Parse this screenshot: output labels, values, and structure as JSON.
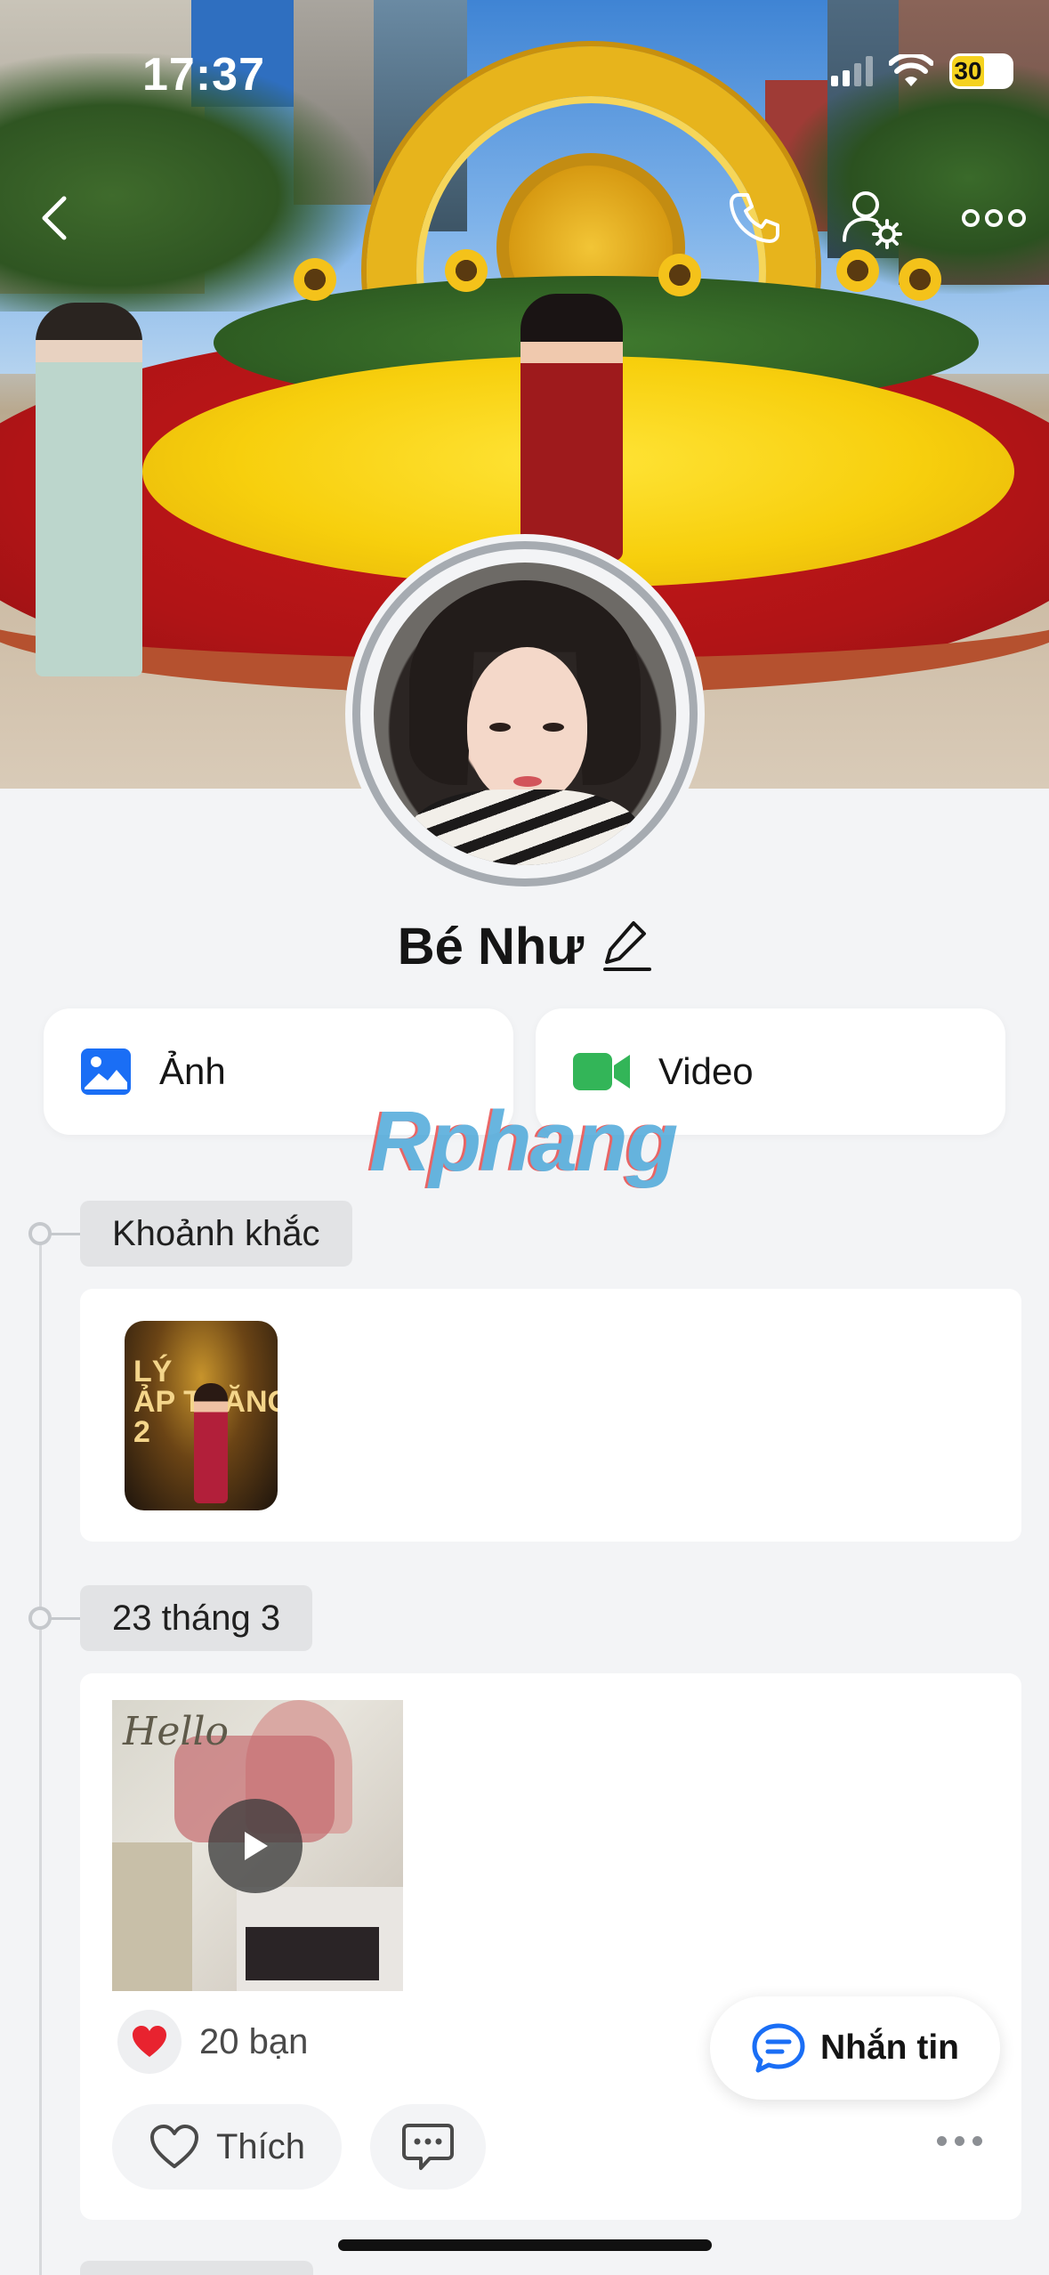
{
  "status_bar": {
    "time": "17:37",
    "battery": "30"
  },
  "profile": {
    "name": "Bé Như"
  },
  "quick_actions": [
    {
      "label": "Ảnh",
      "icon": "photo-icon",
      "color": "#1a6ef5"
    },
    {
      "label": "Video",
      "icon": "video-camera-icon",
      "color": "#33b558"
    }
  ],
  "watermark": "Rphang",
  "timeline": {
    "moments_label": "Khoảnh khắc",
    "moment_thumb_text": "LÝ\nẢP TRĂNG\n2",
    "post_date_label": "23 tháng 3",
    "post": {
      "thumb_text": "Hello",
      "reaction_count": "20 bạn",
      "like_label": "Thích"
    }
  },
  "message_button": {
    "label": "Nhắn tin"
  },
  "colors": {
    "accent": "#1a6ef5",
    "background": "#f3f4f6",
    "heart": "#e8232f"
  }
}
